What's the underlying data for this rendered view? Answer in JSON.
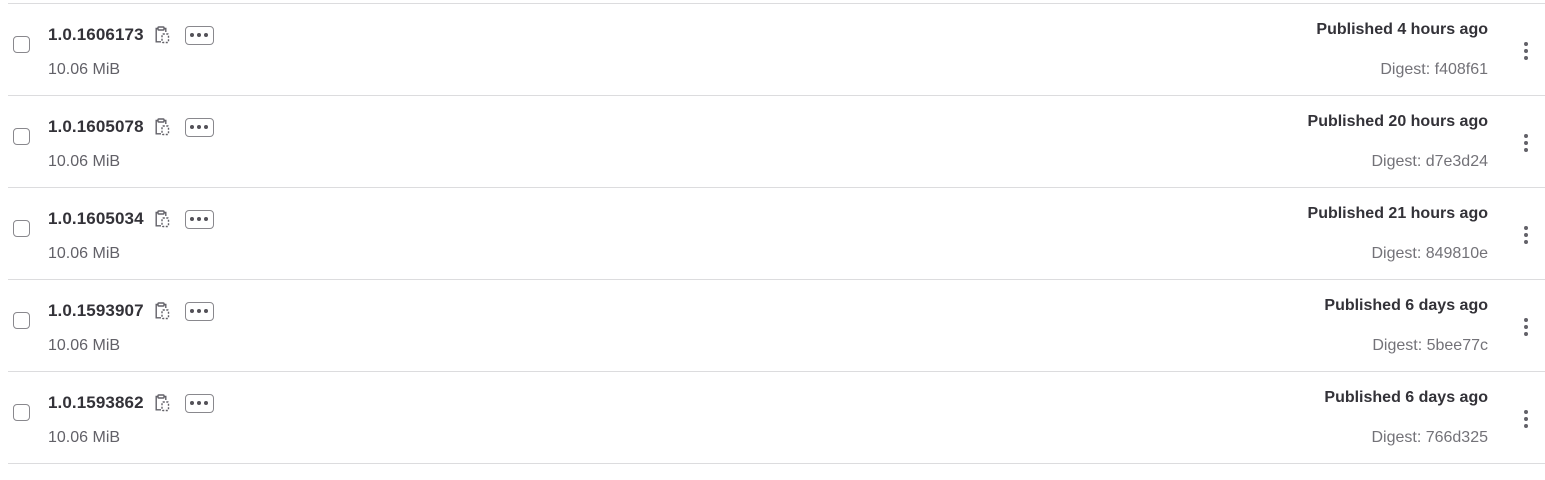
{
  "packages": [
    {
      "version": "1.0.1606173",
      "size": "10.06 MiB",
      "published": "Published 4 hours ago",
      "digest": "Digest: f408f61"
    },
    {
      "version": "1.0.1605078",
      "size": "10.06 MiB",
      "published": "Published 20 hours ago",
      "digest": "Digest: d7e3d24"
    },
    {
      "version": "1.0.1605034",
      "size": "10.06 MiB",
      "published": "Published 21 hours ago",
      "digest": "Digest: 849810e"
    },
    {
      "version": "1.0.1593907",
      "size": "10.06 MiB",
      "published": "Published 6 days ago",
      "digest": "Digest: 5bee77c"
    },
    {
      "version": "1.0.1593862",
      "size": "10.06 MiB",
      "published": "Published 6 days ago",
      "digest": "Digest: 766d325"
    }
  ],
  "icons": {
    "copy": "copy-to-clipboard-icon",
    "more": "ellipsis-icon",
    "actions": "kebab-menu-icon"
  },
  "colors": {
    "text_primary": "#333238",
    "text_secondary": "#737278",
    "border": "#dcdcde"
  }
}
